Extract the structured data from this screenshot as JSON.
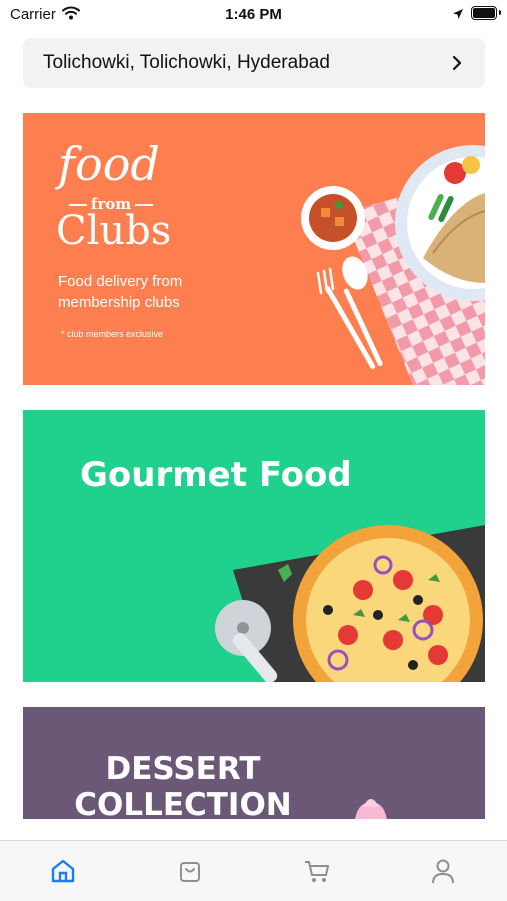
{
  "status_bar": {
    "carrier": "Carrier",
    "time": "1:46 PM",
    "icons": [
      "wifi-icon",
      "location-arrow-icon",
      "battery-icon"
    ]
  },
  "location": {
    "address": "Tolichowki, Tolichowki, Hyderabad",
    "icon": "chevron-right-icon"
  },
  "banners": [
    {
      "id": "food-from-clubs",
      "logo_food": "food",
      "logo_from": "from",
      "logo_clubs": "Clubs",
      "tagline": "Food delivery from membership clubs",
      "note": "* club members exclusive",
      "bg_color": "#fd7e4f"
    },
    {
      "id": "gourmet-food",
      "title": "Gourmet Food",
      "bg_color": "#20d08d"
    },
    {
      "id": "dessert-collection",
      "title_line1": "DESSERT",
      "title_line2": "COLLECTION",
      "bg_color": "#6a5876"
    }
  ],
  "tab_bar": {
    "tabs": [
      {
        "name": "home",
        "icon": "home-icon",
        "active": true
      },
      {
        "name": "shop",
        "icon": "bag-icon",
        "active": false
      },
      {
        "name": "cart",
        "icon": "cart-icon",
        "active": false
      },
      {
        "name": "profile",
        "icon": "user-icon",
        "active": false
      }
    ],
    "active_color": "#1a7cf0",
    "inactive_color": "#8e8e93"
  }
}
